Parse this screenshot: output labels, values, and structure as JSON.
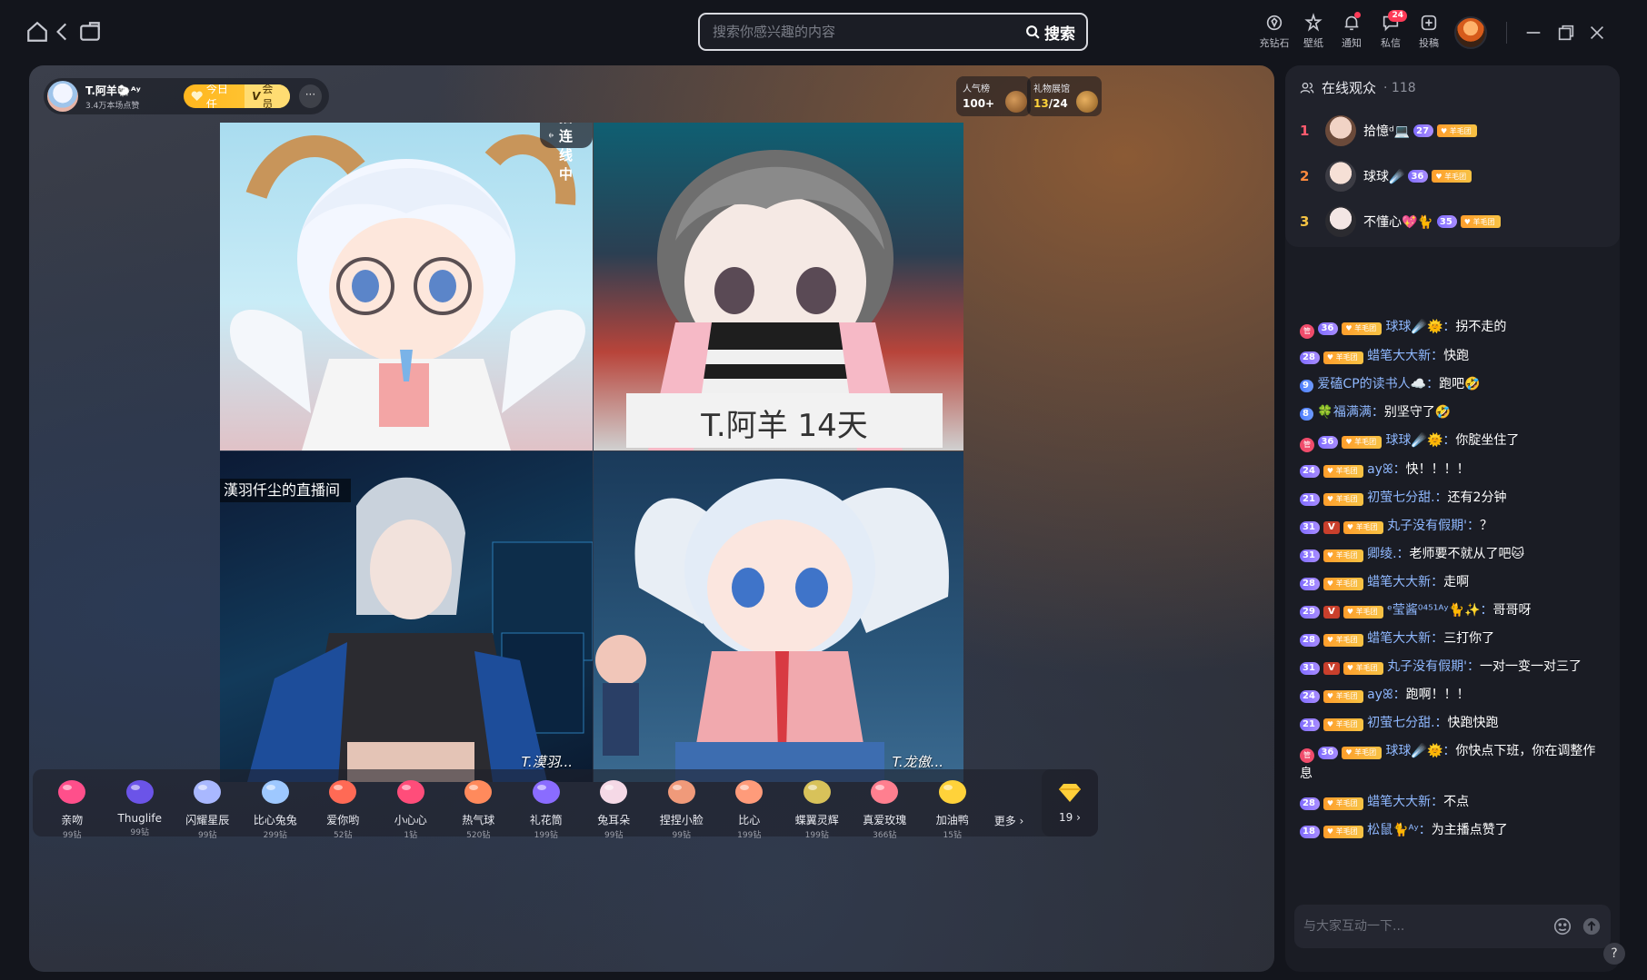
{
  "topbar": {
    "search_placeholder": "搜索你感兴趣的内容",
    "search_label": "搜索",
    "tools": [
      {
        "label": "充钻石",
        "icon": "diamond-coin-icon"
      },
      {
        "label": "壁纸",
        "icon": "wallpaper-icon"
      },
      {
        "label": "通知",
        "icon": "bell-icon"
      },
      {
        "label": "私信",
        "icon": "message-icon",
        "badge": "24"
      },
      {
        "label": "投稿",
        "icon": "upload-icon"
      }
    ]
  },
  "anchor": {
    "name": "T.阿羊🐑ᴬʸ",
    "stats": "3.4万本场点赞",
    "follow_label": "今日任",
    "member_label": "会员",
    "more_label": "···"
  },
  "ranks": {
    "popularity_title": "人气榜",
    "popularity_value": "100+",
    "gift_title": "礼物展馆",
    "gift_value": "13",
    "gift_total": "/24"
  },
  "stream": {
    "link_label": "主播连线中",
    "day_card_text": "T.阿羊  14天",
    "room_title": "漢羽仟尘的直播间",
    "tile_names": [
      "T.漠羽...",
      "T.龙傲..."
    ]
  },
  "gifts": [
    {
      "name": "亲吻",
      "price": "99钻",
      "color": "#ff4f8b"
    },
    {
      "name": "Thuglife",
      "price": "99钻",
      "color": "#6b54e8"
    },
    {
      "name": "闪耀星辰",
      "price": "99钻",
      "color": "#a9b8ff"
    },
    {
      "name": "比心兔兔",
      "price": "299钻",
      "color": "#9ec8ff"
    },
    {
      "name": "爱你哟",
      "price": "52钻",
      "color": "#ff6a55"
    },
    {
      "name": "小心心",
      "price": "1钻",
      "color": "#ff4d7a"
    },
    {
      "name": "热气球",
      "price": "520钻",
      "color": "#ff8a5c"
    },
    {
      "name": "礼花筒",
      "price": "199钻",
      "color": "#8a6cff"
    },
    {
      "name": "兔耳朵",
      "price": "99钻",
      "color": "#f5d9e6"
    },
    {
      "name": "捏捏小脸",
      "price": "99钻",
      "color": "#f09a7a"
    },
    {
      "name": "比心",
      "price": "199钻",
      "color": "#ff9b7a"
    },
    {
      "name": "蝶翼灵辉",
      "price": "199钻",
      "color": "#d8c25a"
    },
    {
      "name": "真爱玫瑰",
      "price": "366钻",
      "color": "#ff7f8f"
    },
    {
      "name": "加油鸭",
      "price": "15钻",
      "color": "#ffd23a"
    }
  ],
  "gift_more_label": "更多 ›",
  "gift_diamond_count": "19 ›",
  "viewers": {
    "title": "在线观众",
    "count": "· 118",
    "list": [
      {
        "rank": "1",
        "name": "拾憶ᵈ💻",
        "level": "27",
        "color": "#ff5b6e"
      },
      {
        "rank": "2",
        "name": "球球☄️",
        "level": "36",
        "color": "#ff8a3d"
      },
      {
        "rank": "3",
        "name": "不懂心💖🐈",
        "level": "35",
        "color": "#f5c343"
      }
    ]
  },
  "chat": [
    {
      "level": "36",
      "role": true,
      "vip": false,
      "nick": "球球☄️🌞",
      "text": "拐不走的"
    },
    {
      "level": "28",
      "role": false,
      "vip": false,
      "nick": "蜡笔大大新",
      "text": "快跑"
    },
    {
      "level": "9",
      "role": false,
      "vip": false,
      "nick": "爱磕CP的读书人☁️",
      "text": "跑吧🤣"
    },
    {
      "level": "8",
      "role": false,
      "vip": false,
      "nick": "🍀福满满",
      "text": "别坚守了🤣"
    },
    {
      "level": "36",
      "role": true,
      "vip": false,
      "nick": "球球☄️🌞",
      "text": "你腚坐住了"
    },
    {
      "level": "24",
      "role": false,
      "vip": false,
      "nick": "ayꕤ",
      "text": "快！！！！"
    },
    {
      "level": "21",
      "role": false,
      "vip": false,
      "nick": "初萤七分甜.",
      "text": "还有2分钟"
    },
    {
      "level": "31",
      "role": false,
      "vip": true,
      "nick": "丸子没有假期'",
      "text": "？"
    },
    {
      "level": "31",
      "role": false,
      "vip": false,
      "nick": "卿绫.",
      "text": "老师要不就从了吧🐱"
    },
    {
      "level": "28",
      "role": false,
      "vip": false,
      "nick": "蜡笔大大新",
      "text": "走啊"
    },
    {
      "level": "29",
      "role": false,
      "vip": true,
      "nick": "ᵉ莹酱⁰⁴⁵¹ᴬʸ🐈✨",
      "text": "哥哥呀"
    },
    {
      "level": "28",
      "role": false,
      "vip": false,
      "nick": "蜡笔大大新",
      "text": "三打你了"
    },
    {
      "level": "31",
      "role": false,
      "vip": true,
      "nick": "丸子没有假期'",
      "text": "一对一变一对三了"
    },
    {
      "level": "24",
      "role": false,
      "vip": false,
      "nick": "ayꕤ",
      "text": "跑啊！！！"
    },
    {
      "level": "21",
      "role": false,
      "vip": false,
      "nick": "初萤七分甜.",
      "text": "快跑快跑"
    },
    {
      "level": "36",
      "role": true,
      "vip": false,
      "nick": "球球☄️🌞",
      "text": "你快点下班，你在调整作息"
    },
    {
      "level": "28",
      "role": false,
      "vip": false,
      "nick": "蜡笔大大新",
      "text": "不点"
    },
    {
      "level": "18",
      "role": false,
      "vip": false,
      "nick": "松鼠🐈ᴬʸ",
      "text": "为主播点赞了"
    }
  ],
  "chat_input_placeholder": "与大家互动一下...",
  "help_label": "?"
}
